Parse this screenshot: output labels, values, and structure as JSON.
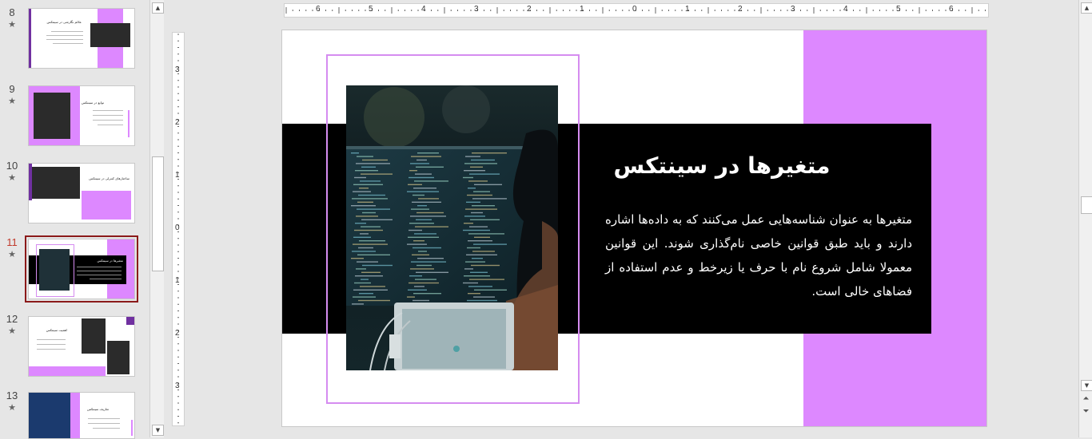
{
  "thumbnails": [
    {
      "number": "8",
      "star": "★",
      "title": "علائم نگارشی در سینتکس"
    },
    {
      "number": "9",
      "star": "★",
      "title": "توابع در سینتکس"
    },
    {
      "number": "10",
      "star": "★",
      "title": "ساختارهای کنترلی در سینتکس"
    },
    {
      "number": "11",
      "star": "★",
      "title": "متغیرها در سینتکس",
      "active": true
    },
    {
      "number": "12",
      "star": "★",
      "title": "اهمیت سینتکس"
    },
    {
      "number": "13",
      "star": "★",
      "title": "تعاریف سینتکس"
    }
  ],
  "ruler": {
    "horizontal": [
      "6",
      "5",
      "4",
      "3",
      "2",
      "1",
      "0",
      "1",
      "2",
      "3",
      "4",
      "5",
      "6"
    ],
    "vertical": [
      "3",
      "2",
      "1",
      "0",
      "1",
      "2",
      "3"
    ]
  },
  "slide": {
    "title": "متغیرها در سینتکس",
    "body": "متغیرها به عنوان شناسه‌هایی عمل می‌کنند که به داده‌ها اشاره دارند و باید طبق قوانین خاصی نام‌گذاری شوند. این قوانین معمولا شامل شروع نام با حرف یا زیرخط و عدم استفاده از فضاهای خالی است.",
    "photo_icon": "programmer-at-monitor-photo"
  },
  "colors": {
    "accent": "#dd88ff",
    "frame": "#d58cf0",
    "band": "#000000",
    "active_border": "#8b1a1a"
  }
}
